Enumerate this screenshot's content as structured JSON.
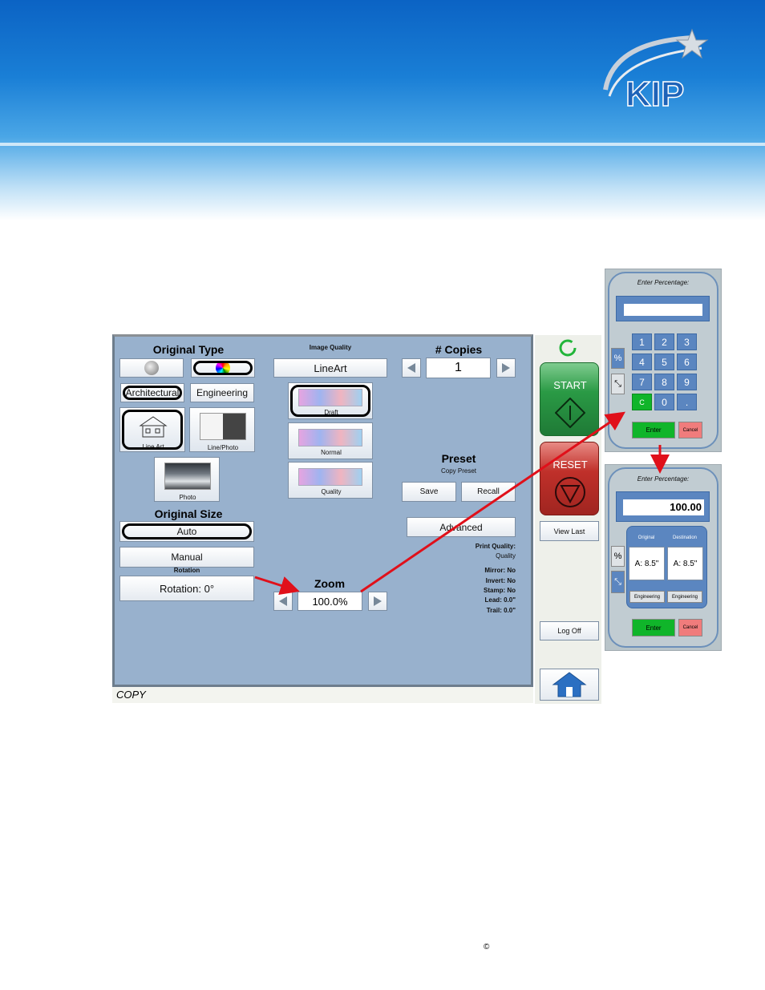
{
  "brand": {
    "logo_text": "KIP"
  },
  "panel": {
    "original_type": {
      "title": "Original Type",
      "buttons": [
        "Architectural",
        "Engineering"
      ],
      "modes": [
        "Line Art",
        "Line/Photo",
        "Photo"
      ]
    },
    "image_quality": {
      "title": "Image Quality",
      "value": "LineArt",
      "options": [
        "Draft",
        "Normal",
        "Quality"
      ]
    },
    "copies": {
      "title": "# Copies",
      "value": "1"
    },
    "preset": {
      "title": "Preset",
      "subtitle": "Copy Preset",
      "save": "Save",
      "recall": "Recall"
    },
    "advanced": "Advanced",
    "print_quality": {
      "label": "Print Quality:",
      "value": "Quality"
    },
    "settings": [
      "Mirror: No",
      "Invert: No",
      "Stamp: No",
      "Lead: 0.0\"",
      "Trail: 0.0\""
    ],
    "original_size": {
      "title": "Original Size",
      "auto": "Auto",
      "manual": "Manual"
    },
    "rotation": {
      "label": "Rotation",
      "value": "Rotation: 0°"
    },
    "zoom": {
      "title": "Zoom",
      "value": "100.0%"
    },
    "status": "COPY"
  },
  "side": {
    "start": "START",
    "reset": "RESET",
    "view_last": "View Last",
    "log_off": "Log Off"
  },
  "keypad1": {
    "title": "Enter Percentage:",
    "keys": [
      "1",
      "2",
      "3",
      "4",
      "5",
      "6",
      "7",
      "8",
      "9",
      "C",
      "0",
      "."
    ],
    "percent": "%",
    "enter": "Enter",
    "cancel": "Cancel"
  },
  "keypad2": {
    "title": "Enter Percentage:",
    "value": "100.00",
    "percent": "%",
    "original_label": "Original",
    "destination_label": "Destination",
    "original_size": "A: 8.5\"",
    "destination_size": "A: 8.5\"",
    "original_series": "Engineering",
    "destination_series": "Engineering",
    "enter": "Enter",
    "cancel": "Cancel"
  },
  "footer": {
    "copyright": "©"
  },
  "colors": {
    "start": "#2a9a45",
    "reset": "#c0302a",
    "enter": "#10b52a",
    "cancel": "#f07c7c",
    "arrow": "#e0101a"
  }
}
